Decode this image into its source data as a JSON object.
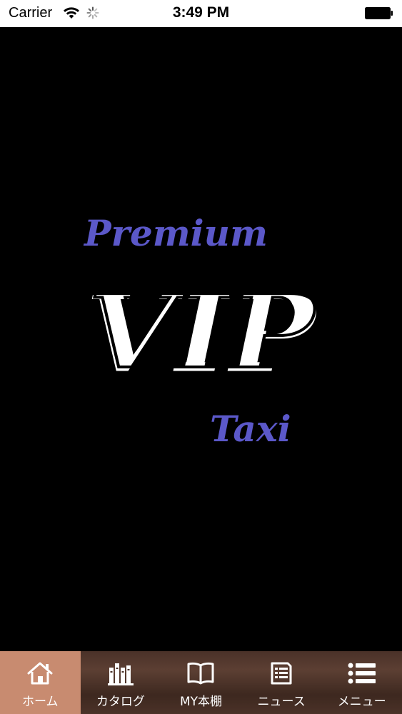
{
  "status_bar": {
    "carrier": "Carrier",
    "time": "3:49 PM",
    "icons": [
      "wifi-icon",
      "activity-spinner-icon",
      "battery-icon"
    ]
  },
  "splash": {
    "top_text": "Premium",
    "main_text": "VIP",
    "bottom_text": "Taxi",
    "accent_color": "#5b58c9",
    "main_color": "#ffffff",
    "background_color": "#000000"
  },
  "tab_bar": {
    "active_color": "#c88b70",
    "tabs": [
      {
        "label": "ホーム",
        "icon": "home-icon",
        "active": true
      },
      {
        "label": "カタログ",
        "icon": "books-icon",
        "active": false
      },
      {
        "label": "MY本棚",
        "icon": "open-book-icon",
        "active": false
      },
      {
        "label": "ニュース",
        "icon": "news-icon",
        "active": false
      },
      {
        "label": "メニュー",
        "icon": "menu-list-icon",
        "active": false
      }
    ]
  }
}
